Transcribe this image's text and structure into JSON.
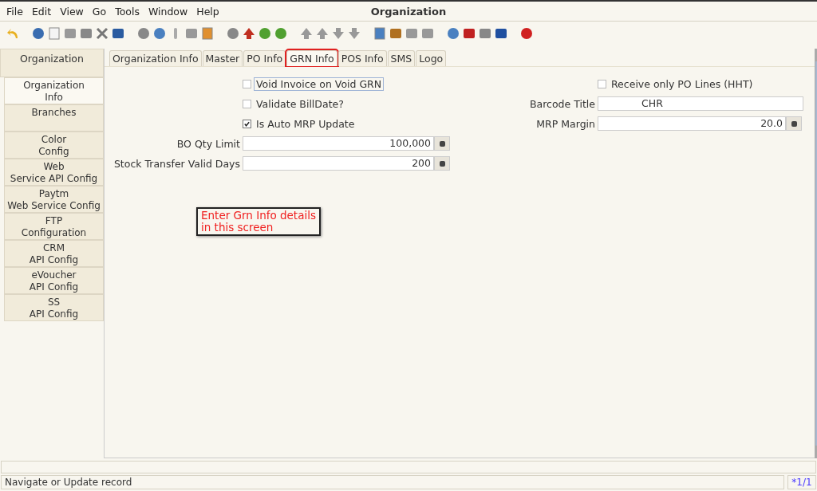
{
  "window": {
    "title": "Organization"
  },
  "menu": [
    "File",
    "Edit",
    "View",
    "Go",
    "Tools",
    "Window",
    "Help"
  ],
  "sidebar": {
    "header": "Organization",
    "items": [
      {
        "label": "Organization\nInfo",
        "selected": true
      },
      {
        "label": "Branches",
        "selected": false
      },
      {
        "label": "Color\nConfig",
        "selected": false
      },
      {
        "label": "Web\nService API Config",
        "selected": false
      },
      {
        "label": "Paytm\nWeb Service Config",
        "selected": false
      },
      {
        "label": "FTP\nConfiguration",
        "selected": false
      },
      {
        "label": "CRM\nAPI Config",
        "selected": false
      },
      {
        "label": "eVoucher\nAPI Config",
        "selected": false
      },
      {
        "label": "SS\nAPI Config",
        "selected": false
      }
    ]
  },
  "tabs": [
    {
      "label": "Organization Info",
      "selected": false,
      "highlighted": false
    },
    {
      "label": "Master",
      "selected": false,
      "highlighted": false
    },
    {
      "label": "PO Info",
      "selected": false,
      "highlighted": false
    },
    {
      "label": "GRN Info",
      "selected": true,
      "highlighted": true
    },
    {
      "label": "POS Info",
      "selected": false,
      "highlighted": false
    },
    {
      "label": "SMS",
      "selected": false,
      "highlighted": false
    },
    {
      "label": "Logo",
      "selected": false,
      "highlighted": false
    }
  ],
  "left_fields": [
    {
      "kind": "checkbox",
      "label": "Void Invoice on Void GRN",
      "checked": false,
      "focused": true
    },
    {
      "kind": "checkbox",
      "label": "Validate BillDate?",
      "checked": false,
      "focused": false
    },
    {
      "kind": "checkbox",
      "label": "Is Auto MRP Update",
      "checked": true,
      "focused": false
    },
    {
      "kind": "number",
      "label": "BO Qty Limit",
      "value": "100,000"
    },
    {
      "kind": "number",
      "label": "Stock Transfer Valid Days",
      "value": "200"
    }
  ],
  "right_fields": [
    {
      "kind": "checkbox",
      "label": "Receive only PO Lines (HHT)",
      "checked": false,
      "focused": false
    },
    {
      "kind": "text",
      "label": "Barcode Title",
      "value": "CHR"
    },
    {
      "kind": "number",
      "label": "MRP Margin",
      "value": "20.0"
    }
  ],
  "callout": "Enter Grn Info details\nin this screen",
  "status_bar": {
    "message": "Navigate or Update record",
    "record": "*1/1"
  }
}
